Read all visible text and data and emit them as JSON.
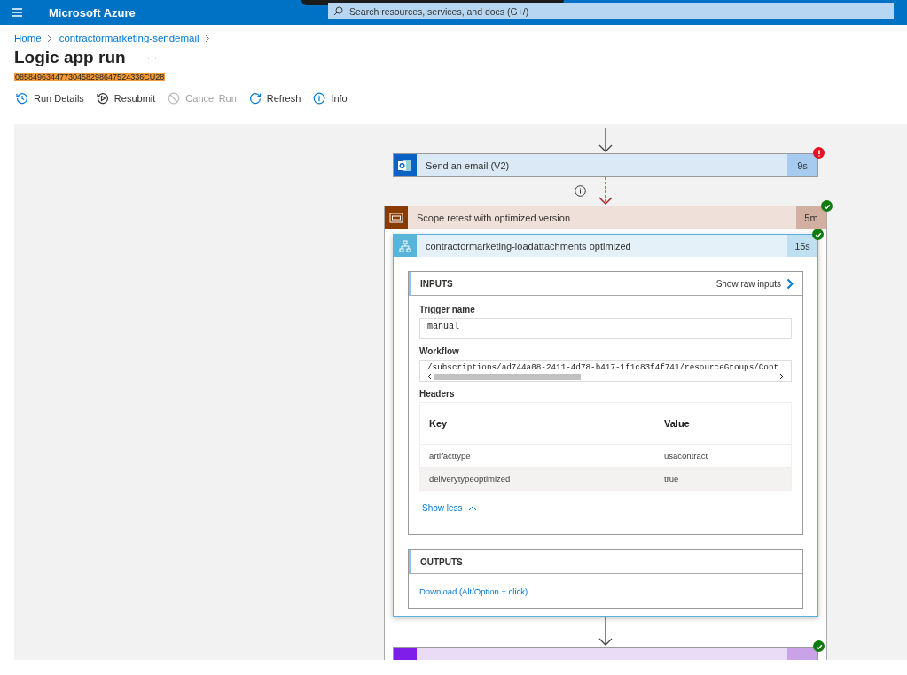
{
  "topbar": {
    "brand": "Microsoft Azure",
    "search_placeholder": "Search resources, services, and docs (G+/)"
  },
  "breadcrumb": [
    "Home",
    "contractormarketing-sendemail"
  ],
  "page": {
    "title": "Logic app run",
    "more": "···",
    "run_id": "08584963447730458298647524336CU28"
  },
  "toolbar": [
    {
      "label": "Run Details",
      "kind": "history",
      "disabled": false
    },
    {
      "label": "Resubmit",
      "kind": "resubmit",
      "disabled": false
    },
    {
      "label": "Cancel Run",
      "kind": "cancel",
      "disabled": true
    },
    {
      "label": "Refresh",
      "kind": "refresh",
      "disabled": false
    },
    {
      "label": "Info",
      "kind": "info",
      "disabled": false
    }
  ],
  "flow": {
    "send": {
      "title": "Send an email (V2)",
      "duration": "9s",
      "failed": true
    },
    "scope": {
      "title": "Scope retest with optimized version",
      "duration": "5m",
      "failed": false
    },
    "action": {
      "title": "contractormarketing-loadattachments optimized",
      "duration": "15s",
      "failed": false,
      "inputs": {
        "heading": "INPUTS",
        "raw_link": "Show raw inputs",
        "fields": [
          {
            "label": "Trigger name",
            "value": "manual",
            "kind": "text"
          },
          {
            "label": "Workflow",
            "value": "/subscriptions/ad744a08-2411-4d78-b417-1f1c83f4f741/resourceGroups/Cont",
            "kind": "scroll"
          }
        ],
        "headers": {
          "label": "Headers",
          "columns": [
            "Key",
            "Value"
          ],
          "rows": [
            {
              "key": "artifacttype",
              "value": "usacontract",
              "selected": false
            },
            {
              "key": "deliverytypeoptimized",
              "value": "true",
              "selected": true
            }
          ],
          "toggle": "Show less"
        }
      },
      "outputs": {
        "heading": "OUTPUTS",
        "link": "Download (Alt/Option + click)"
      }
    },
    "next": {
      "failed": false
    }
  }
}
